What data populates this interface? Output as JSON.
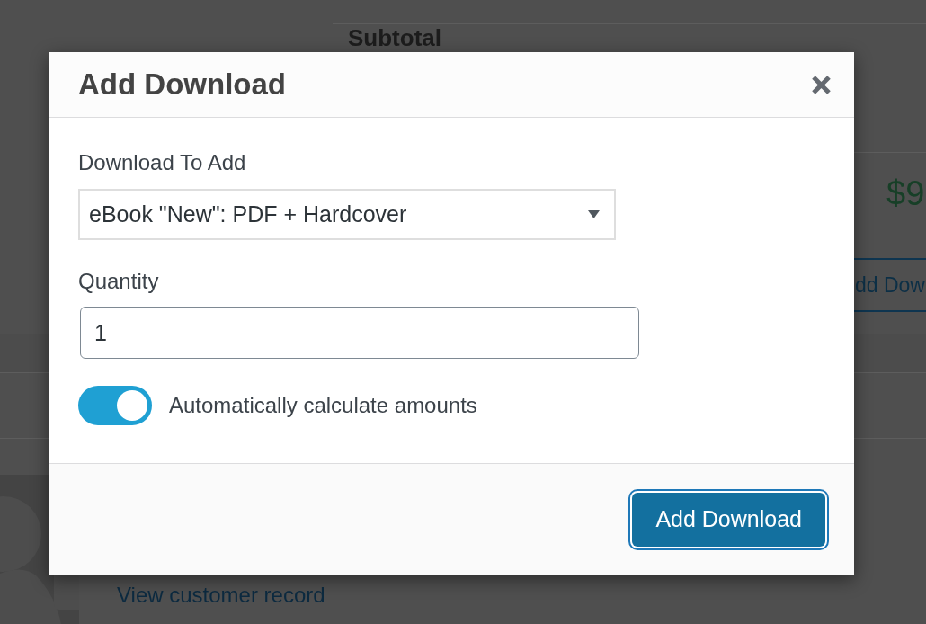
{
  "background_page": {
    "section_heading": "Subtotal",
    "amount": "$9",
    "add_button": "dd Dow",
    "customer_link": "View customer record"
  },
  "dialog": {
    "title": "Add Download",
    "fields": [
      {
        "kind": "select",
        "label": "Download To Add",
        "value": "eBook \"New\": PDF + Hardcover"
      },
      {
        "kind": "number",
        "label": "Quantity",
        "value": "1"
      },
      {
        "kind": "toggle",
        "label": "Automatically calculate amounts",
        "on": true
      }
    ],
    "footer": {
      "button": {
        "label": "Add Download",
        "focused": true
      }
    }
  }
}
